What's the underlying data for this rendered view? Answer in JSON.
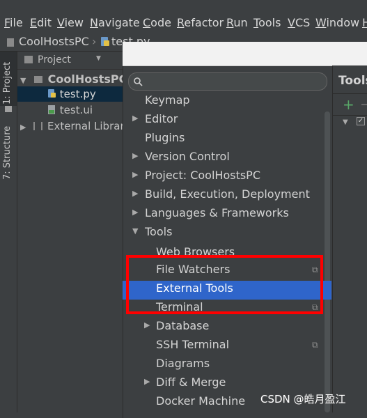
{
  "menubar": {
    "items": [
      {
        "first": "F",
        "rest": "ile"
      },
      {
        "first": "E",
        "rest": "dit"
      },
      {
        "first": "V",
        "rest": "iew"
      },
      {
        "first": "N",
        "rest": "avigate"
      },
      {
        "first": "C",
        "rest": "ode"
      },
      {
        "first": "R",
        "rest": "efactor"
      },
      {
        "first": "R",
        "rest": "un"
      },
      {
        "first": "T",
        "rest": "ools"
      },
      {
        "first": "V",
        "rest": "CS"
      },
      {
        "first": "W",
        "rest": "indow"
      },
      {
        "first": "H",
        "rest": ""
      }
    ]
  },
  "breadcrumb": {
    "project": "CoolHostsPC",
    "file": "test.py"
  },
  "tool_stripe": {
    "project_tab": "1: Project",
    "structure_tab": "7: Structure"
  },
  "project_panel": {
    "header": "Project",
    "tree": [
      {
        "label": "CoolHostsPC",
        "expanded": true
      },
      {
        "label": "test.py"
      },
      {
        "label": "test.ui"
      },
      {
        "label": "External Libraries",
        "collapsed": true
      }
    ]
  },
  "settings": {
    "search_placeholder": "",
    "items": [
      {
        "label": "Keymap"
      },
      {
        "label": "Editor"
      },
      {
        "label": "Plugins"
      },
      {
        "label": "Version Control"
      },
      {
        "label": "Project: CoolHostsPC"
      },
      {
        "label": "Build, Execution, Deployment"
      },
      {
        "label": "Languages & Frameworks"
      },
      {
        "label": "Tools"
      },
      {
        "label": "Web Browsers"
      },
      {
        "label": "File Watchers"
      },
      {
        "label": "External Tools"
      },
      {
        "label": "Terminal"
      },
      {
        "label": "Database"
      },
      {
        "label": "SSH Terminal"
      },
      {
        "label": "Diagrams"
      },
      {
        "label": "Diff & Merge"
      },
      {
        "label": "Docker Machine"
      }
    ],
    "selected": "External Tools"
  },
  "right_panel": {
    "title": "Tools"
  },
  "watermark": "CSDN @皓月盈江",
  "colors": {
    "selection": "#2f65ca",
    "highlight_box": "#ff0000",
    "add_icon": "#59a869"
  }
}
